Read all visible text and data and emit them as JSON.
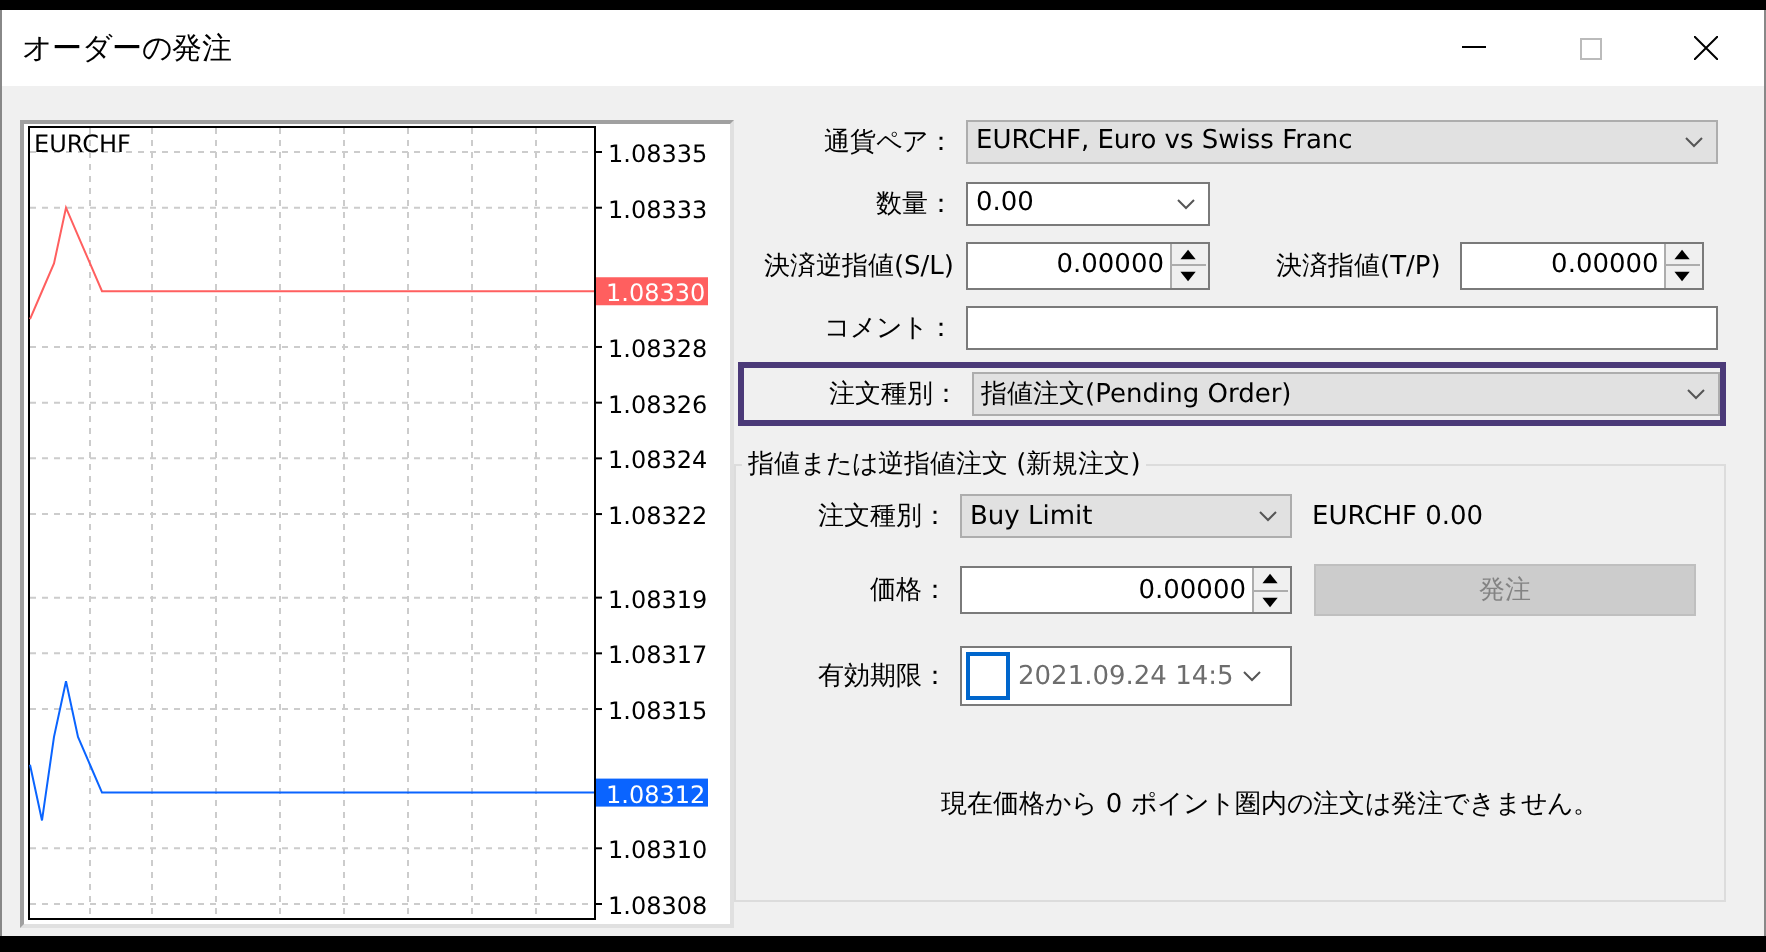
{
  "window": {
    "title": "オーダーの発注"
  },
  "chart": {
    "chart_data": {
      "type": "line",
      "title": "EURCHF",
      "grid": true,
      "categories": [
        null,
        null,
        null,
        null,
        null,
        null,
        null,
        null,
        null,
        null,
        null,
        null,
        null,
        null,
        null,
        null,
        null,
        null,
        null,
        null,
        null,
        null,
        null,
        null,
        null,
        null,
        null,
        null,
        null,
        null,
        null,
        null,
        null,
        null,
        null,
        null,
        null,
        null,
        null,
        null,
        null,
        null,
        null,
        null,
        null,
        null,
        null,
        null
      ],
      "ylim": [
        1.08308,
        1.08335
      ],
      "yticks": [
        {
          "value": 1.08335,
          "label": "1.08335"
        },
        {
          "value": 1.08333,
          "label": "1.08333"
        },
        {
          "value": 1.08328,
          "label": "1.08328"
        },
        {
          "value": 1.08326,
          "label": "1.08326"
        },
        {
          "value": 1.08324,
          "label": "1.08324"
        },
        {
          "value": 1.08322,
          "label": "1.08322"
        },
        {
          "value": 1.08319,
          "label": "1.08319"
        },
        {
          "value": 1.08317,
          "label": "1.08317"
        },
        {
          "value": 1.08315,
          "label": "1.08315"
        },
        {
          "value": 1.0831,
          "label": "1.08310"
        },
        {
          "value": 1.08308,
          "label": "1.08308"
        }
      ],
      "series": [
        {
          "color": "#ff5f5f",
          "values": [
            1.08329,
            1.0833,
            1.08331,
            1.08333,
            1.08332,
            1.08331,
            1.0833,
            1.0833,
            1.0833,
            1.0833,
            1.0833,
            1.0833,
            1.0833,
            1.0833,
            1.0833,
            1.0833,
            1.0833,
            1.0833,
            1.0833,
            1.0833,
            1.0833,
            1.0833,
            1.0833,
            1.0833,
            1.0833,
            1.0833,
            1.0833,
            1.0833,
            1.0833,
            1.0833,
            1.0833,
            1.0833,
            1.0833,
            1.0833,
            1.0833,
            1.0833,
            1.0833,
            1.0833,
            1.0833,
            1.0833,
            1.0833,
            1.0833,
            1.0833,
            1.0833,
            1.0833,
            1.0833,
            1.0833,
            1.0833
          ]
        },
        {
          "color": "#0a64ff",
          "values": [
            1.08313,
            1.08311,
            1.08314,
            1.08316,
            1.08314,
            1.08313,
            1.08312,
            1.08312,
            1.08312,
            1.08312,
            1.08312,
            1.08312,
            1.08312,
            1.08312,
            1.08312,
            1.08312,
            1.08312,
            1.08312,
            1.08312,
            1.08312,
            1.08312,
            1.08312,
            1.08312,
            1.08312,
            1.08312,
            1.08312,
            1.08312,
            1.08312,
            1.08312,
            1.08312,
            1.08312,
            1.08312,
            1.08312,
            1.08312,
            1.08312,
            1.08312,
            1.08312,
            1.08312,
            1.08312,
            1.08312,
            1.08312,
            1.08312,
            1.08312,
            1.08312,
            1.08312,
            1.08312,
            1.08312,
            1.08312
          ]
        }
      ]
    },
    "price_tags": [
      "1.08330",
      "1.08312"
    ]
  },
  "form": {
    "symbol": {
      "label": "通貨ペア：",
      "value": "EURCHF, Euro vs Swiss Franc"
    },
    "volume": {
      "label": "数量：",
      "value": "0.00"
    },
    "stop_loss": {
      "label": "決済逆指値(S/L)",
      "value": "0.00000"
    },
    "take_profit": {
      "label": "決済指値(T/P)",
      "value": "0.00000"
    },
    "comment": {
      "label": "コメント："
    },
    "order_type": {
      "label": "注文種別：",
      "value": "指値注文(Pending Order)",
      "highlighted": true
    }
  },
  "pending": {
    "title": "指値または逆指値注文 (新規注文)",
    "type": {
      "label": "注文種別：",
      "value": "Buy Limit"
    },
    "symbol_info": "EURCHF 0.00",
    "price": {
      "label": "価格：",
      "value": "0.00000"
    },
    "place_button": {
      "label": "発注",
      "disabled": true
    },
    "expiry": {
      "label": "有効期限：",
      "checked": false,
      "value": "2021.09.24 14:5"
    },
    "note": "現在価格から 0 ポイント圏内の注文は発注できません。"
  }
}
